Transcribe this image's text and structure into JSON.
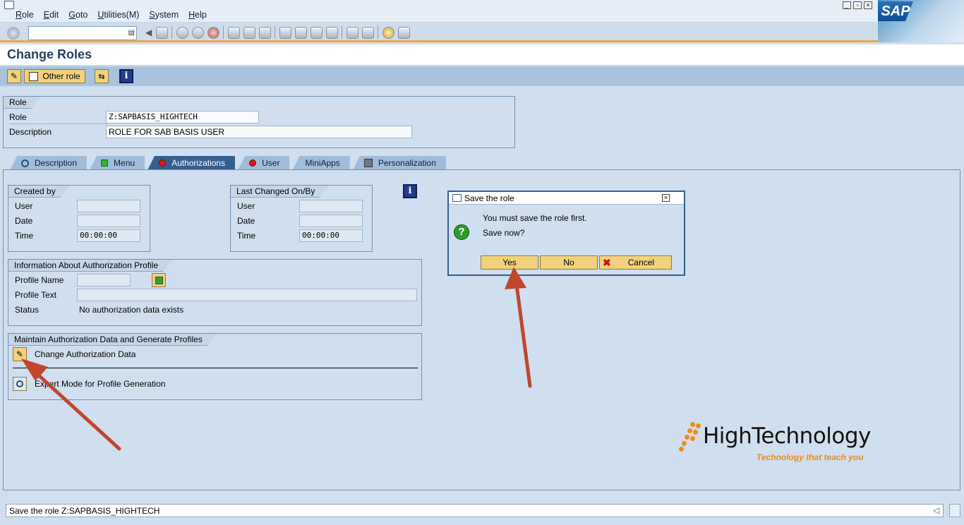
{
  "menu": {
    "items": [
      "Role",
      "Edit",
      "Goto",
      "Utilities(M)",
      "System",
      "Help"
    ]
  },
  "window_controls": [
    "minimize-icon",
    "restore-icon",
    "close-icon"
  ],
  "brand": {
    "logo_text": "SAP"
  },
  "command_field": {
    "value": ""
  },
  "toolbar_icons": [
    "enter-icon",
    "back-icon",
    "save-icon",
    "back-nav-icon",
    "exit-icon",
    "cancel-icon",
    "print-icon",
    "find-icon",
    "find-next-icon",
    "first-page-icon",
    "prev-page-icon",
    "next-page-icon",
    "last-page-icon",
    "new-session-icon",
    "shortcut-icon",
    "help-icon",
    "layout-icon"
  ],
  "page": {
    "title": "Change Roles"
  },
  "app_toolbar": {
    "other_role_label": "Other role"
  },
  "role_group": {
    "title": "Role",
    "role_label": "Role",
    "role_value": "Z:SAPBASIS_HIGHTECH",
    "description_label": "Description",
    "description_value": "ROLE FOR SAB BASIS USER"
  },
  "tabs": [
    {
      "label": "Description",
      "icon": "magnifier-icon"
    },
    {
      "label": "Menu",
      "icon": "green-status-icon"
    },
    {
      "label": "Authorizations",
      "icon": "red-status-icon"
    },
    {
      "label": "User",
      "icon": "red-status-icon"
    },
    {
      "label": "MiniApps",
      "icon": ""
    },
    {
      "label": "Personalization",
      "icon": "personalization-icon"
    }
  ],
  "created_by": {
    "title": "Created by",
    "user_label": "User",
    "user_value": "",
    "date_label": "Date",
    "date_value": "",
    "time_label": "Time",
    "time_value": "00:00:00"
  },
  "last_changed": {
    "title": "Last Changed On/By",
    "user_label": "User",
    "user_value": "",
    "date_label": "Date",
    "date_value": "",
    "time_label": "Time",
    "time_value": "00:00:00"
  },
  "auth_profile": {
    "title": "Information About Authorization Profile",
    "profile_name_label": "Profile Name",
    "profile_name_value": "",
    "profile_text_label": "Profile Text",
    "profile_text_value": "",
    "status_label": "Status",
    "status_value": "No authorization data exists"
  },
  "maintain": {
    "title": "Maintain Authorization Data and Generate Profiles",
    "change_label": "Change Authorization Data",
    "expert_label": "Expert Mode for Profile Generation"
  },
  "dialog": {
    "title": "Save the role",
    "message_line1": "You must save the role first.",
    "message_line2": "Save now?",
    "yes_label": "Yes",
    "no_label": "No",
    "cancel_label": "Cancel"
  },
  "watermark": {
    "name": "HighTechnology",
    "tagline": "Technology that teach you",
    "color": "#f08a1c"
  },
  "status_bar": {
    "message": "Save the role Z:SAPBASIS_HIGHTECH"
  },
  "colors": {
    "background": "#d0dfef",
    "accent_orange": "#f0a64a",
    "button_yellow": "#f2d27c",
    "active_tab": "#355f8f",
    "annotation_arrow": "#c0462e"
  }
}
